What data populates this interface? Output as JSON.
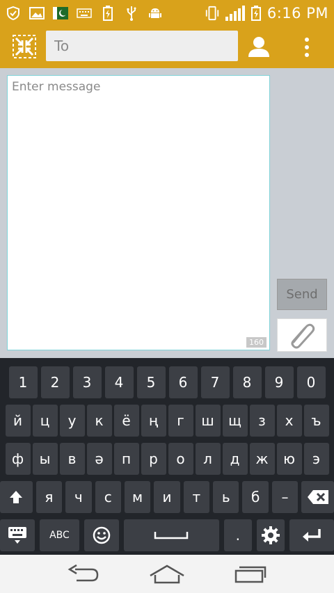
{
  "status_bar": {
    "time": "6:16 PM",
    "icons_left": [
      "shield-icon",
      "gallery-icon",
      "flag-icon",
      "keyboard-icon",
      "battery-charging-icon",
      "usb-icon",
      "android-icon"
    ],
    "icons_right": [
      "vibrate-icon",
      "signal-icon",
      "battery-icon"
    ]
  },
  "header": {
    "to_placeholder": "To",
    "background_color": "#d9a21b"
  },
  "compose": {
    "message_placeholder": "Enter message",
    "char_counter": "160",
    "send_label": "Send"
  },
  "keyboard": {
    "number_row": [
      "1",
      "2",
      "3",
      "4",
      "5",
      "6",
      "7",
      "8",
      "9",
      "0"
    ],
    "row1": [
      "й",
      "ц",
      "у",
      "к",
      "ё",
      "ң",
      "г",
      "ш",
      "щ",
      "з",
      "х",
      "ъ"
    ],
    "row2": [
      "ф",
      "ы",
      "в",
      "ә",
      "п",
      "р",
      "о",
      "л",
      "д",
      "ж",
      "ю",
      "э"
    ],
    "row3": [
      "я",
      "ч",
      "с",
      "м",
      "и",
      "т",
      "ь",
      "б",
      "–"
    ],
    "abc_label": "ABC",
    "period_label": "."
  }
}
